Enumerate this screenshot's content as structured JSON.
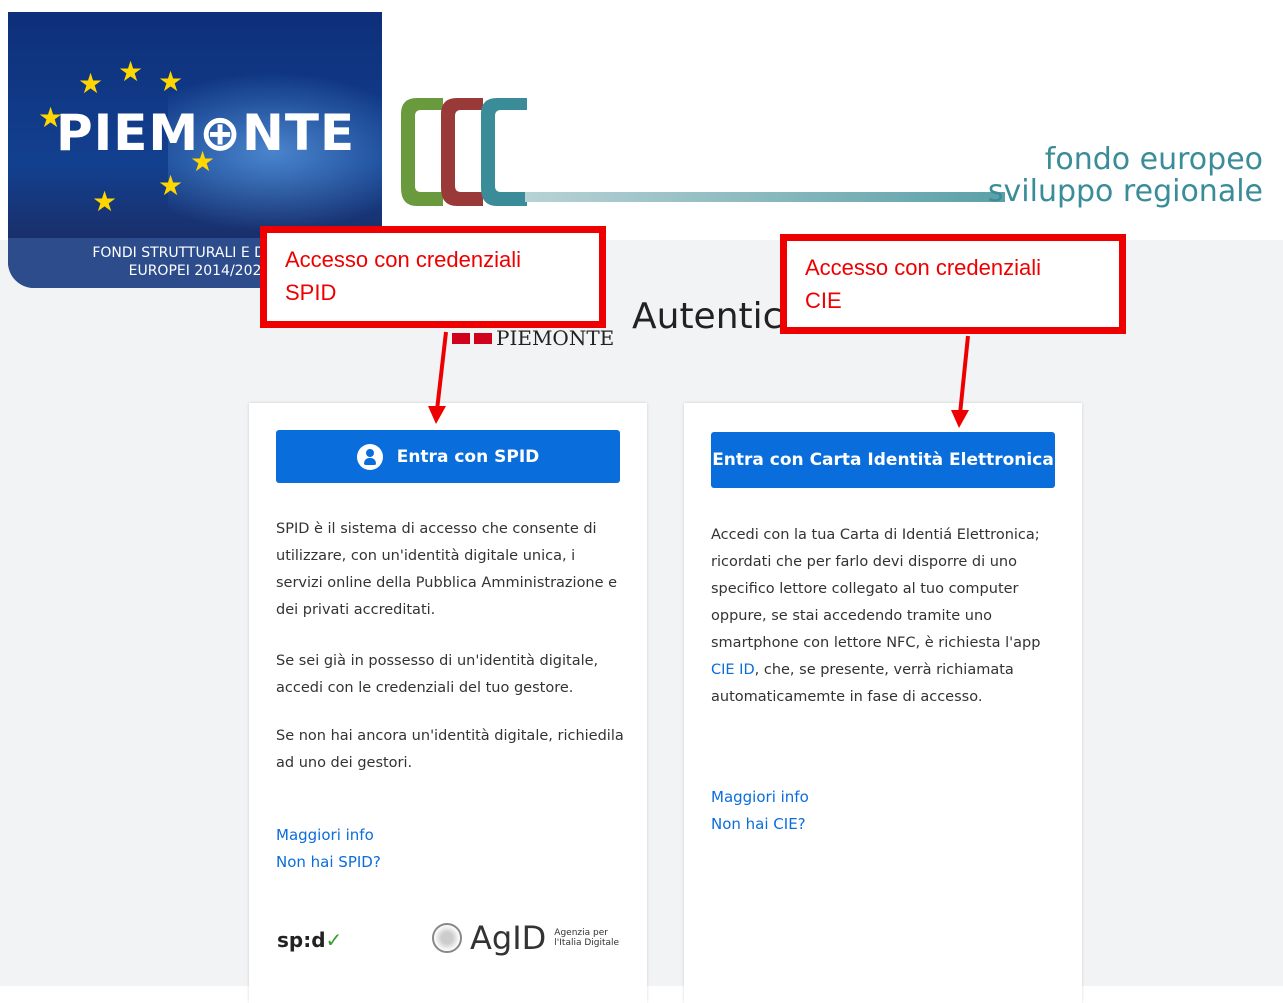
{
  "banner": {
    "piemonte_logo_word": "PIEM⊕NTE",
    "piemonte_logo_sub_line1": "FONDI STRUTTURALI E DI INV",
    "piemonte_logo_sub_line2": "EUROPEI 2014/202",
    "fesr_line1": "fondo europeo",
    "fesr_line2": "sviluppo regionale",
    "fesr_mark": "CCC"
  },
  "header": {
    "logo_text": "PIEMONTE",
    "title": "Autenticazione"
  },
  "spid_card": {
    "button_label": "Entra con SPID",
    "p1": "SPID è il sistema di accesso che consente di utilizzare, con un'identità digitale unica, i servizi online della Pubblica Amministrazione e dei privati accreditati.",
    "p2": "Se sei già in possesso di un'identità digitale, accedi con le credenziali del tuo gestore.",
    "p3": "Se non hai ancora un'identità digitale, richiedila ad uno dei gestori.",
    "link_info": "Maggiori info",
    "link_no_account": "Non hai SPID?",
    "spid_logo": "sp:d",
    "agid_logo": "AgID",
    "agid_sub1": "Agenzia per",
    "agid_sub2": "l'Italia Digitale"
  },
  "cie_card": {
    "button_label": "Entra con Carta Identità Elettronica",
    "p1_before_link": "Accedi con la tua Carta di Identiá Elettronica; ricordati che per farlo devi disporre di uno specifico lettore collegato al tuo computer oppure, se stai accedendo tramite uno smartphone con lettore NFC, è richiesta l'app ",
    "p1_link": "CIE ID",
    "p1_after_link": ", che, se presente, verrà richiamata automaticamemte in fase di accesso.",
    "link_info": "Maggiori info",
    "link_no_account": "Non hai CIE?"
  },
  "annotations": {
    "spid_line1": "Accesso con credenziali",
    "spid_line2": "SPID",
    "cie_line1": "Accesso con credenziali",
    "cie_line2": "CIE"
  },
  "colors": {
    "primary_blue": "#0a6ddc",
    "annotation_red": "#ee0000",
    "fesr_teal": "#3a8d98"
  }
}
